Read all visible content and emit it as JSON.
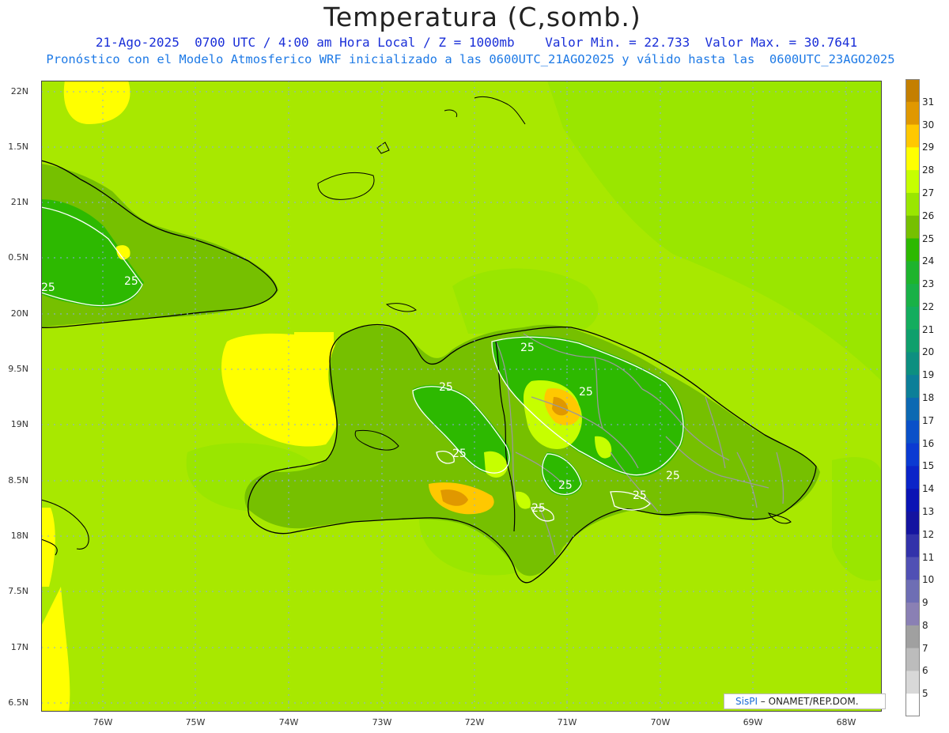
{
  "title": "Temperatura (C,somb.)",
  "subtitle_1": "21-Ago-2025  0700 UTC / 4:00 am Hora Local / Z = 1000mb    Valor Min. = 22.733  Valor Max. = 30.7641",
  "subtitle_2": "Pronóstico con el Modelo Atmosferico WRF inicializado a las 0600UTC_21AGO2025 y válido hasta las  0600UTC_23AGO2025",
  "lat_labels": [
    "22N",
    "1.5N",
    "21N",
    "0.5N",
    "20N",
    "9.5N",
    "19N",
    "8.5N",
    "18N",
    "7.5N",
    "17N",
    "6.5N"
  ],
  "lon_labels": [
    "76W",
    "75W",
    "74W",
    "73W",
    "72W",
    "71W",
    "70W",
    "69W",
    "68W"
  ],
  "contour_labels": [
    "25",
    "25",
    "25",
    "25",
    "25",
    "25",
    "25",
    "25",
    "25",
    "25"
  ],
  "legend": {
    "labels": [
      "31",
      "30",
      "29",
      "28",
      "27",
      "26",
      "25",
      "24",
      "23",
      "22",
      "21",
      "20",
      "19",
      "18",
      "17",
      "16",
      "15",
      "14",
      "13",
      "12",
      "11",
      "10",
      "9",
      "8",
      "7",
      "6",
      "5"
    ],
    "colors": [
      "#c47f00",
      "#e09800",
      "#ffc800",
      "#ffff00",
      "#c6ff00",
      "#9ae600",
      "#76c000",
      "#2db900",
      "#1eb42d",
      "#19b147",
      "#14ad5e",
      "#0f9f6c",
      "#0d8f80",
      "#0c7f98",
      "#0c69b2",
      "#0a50c8",
      "#0a3ad2",
      "#0a24c8",
      "#0a14b4",
      "#1414a0",
      "#3232aa",
      "#5050b4",
      "#6e6eb4",
      "#8a80b4",
      "#a0a0a0",
      "#bcbcbc",
      "#d8d8d8",
      "#ffffff"
    ]
  },
  "credit": {
    "brand": "SisPI",
    "org": " – ONAMET/REP.DOM."
  },
  "colors": {
    "sea": "#a8e800",
    "sea_warm": "#ffff00",
    "land_25": "#76c000",
    "land_24": "#2db900",
    "land_warm": "#c6ff00",
    "land_hot": "#ffc800",
    "land_hottest": "#e09800"
  }
}
